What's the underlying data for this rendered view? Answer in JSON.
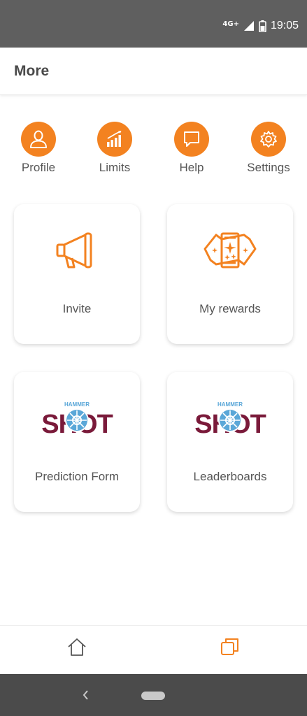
{
  "status_bar": {
    "network": "4G+",
    "time": "19:05"
  },
  "header": {
    "title": "More"
  },
  "quick_actions": [
    {
      "label": "Profile",
      "icon": "person-icon"
    },
    {
      "label": "Limits",
      "icon": "bar-chart-icon"
    },
    {
      "label": "Help",
      "icon": "chat-bubble-icon"
    },
    {
      "label": "Settings",
      "icon": "gear-icon"
    }
  ],
  "cards": [
    {
      "label": "Invite",
      "icon": "megaphone-icon"
    },
    {
      "label": "My rewards",
      "icon": "tickets-icon"
    },
    {
      "label": "Prediction Form",
      "icon": "hammer-shot-logo",
      "logo_text": "SHOT",
      "logo_small_text": "HAMMER"
    },
    {
      "label": "Leaderboards",
      "icon": "hammer-shot-logo",
      "logo_text": "SHOT",
      "logo_small_text": "HAMMER"
    }
  ],
  "bottom_nav": [
    {
      "icon": "home-icon",
      "active": false
    },
    {
      "icon": "copy-icon",
      "active": true
    }
  ],
  "colors": {
    "accent": "#f38220",
    "status_bar": "#5f5f5f",
    "system_nav": "#4b4b4b",
    "logo_maroon": "#7a1a3a",
    "logo_blue": "#5aa7d8"
  }
}
